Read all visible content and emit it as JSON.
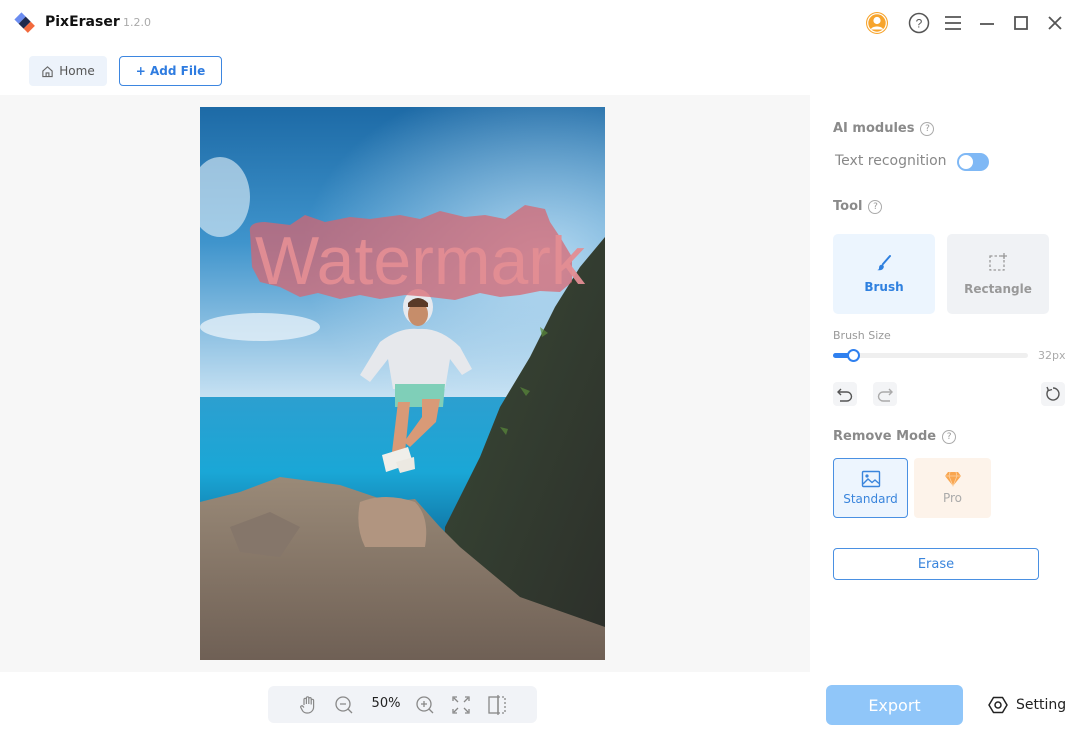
{
  "app": {
    "name": "PixEraser",
    "version": "1.2.0"
  },
  "window_controls": [
    {
      "name": "account-icon",
      "label": "Account"
    },
    {
      "name": "help-icon",
      "label": "Help"
    },
    {
      "name": "menu-icon",
      "label": "Menu"
    },
    {
      "name": "minimize-icon",
      "label": "Minimize"
    },
    {
      "name": "maximize-icon",
      "label": "Maximize"
    },
    {
      "name": "close-icon",
      "label": "Close"
    }
  ],
  "nav": {
    "home_label": "Home",
    "add_file_label": "+ Add File"
  },
  "canvas": {
    "watermark_text": "Watermark",
    "zoom_level": "50%",
    "mask_color": "#d9646e"
  },
  "panel": {
    "ai_modules_title": "AI modules",
    "text_recognition_label": "Text recognition",
    "text_recognition_enabled": false,
    "tool_title": "Tool",
    "tools": [
      {
        "label": "Brush",
        "selected": true
      },
      {
        "label": "Rectangle",
        "selected": false
      }
    ],
    "brush_size_label": "Brush Size",
    "brush_size_value": "32px",
    "brush_size_fraction": 0.1,
    "remove_mode_title": "Remove Mode",
    "modes": [
      {
        "label": "Standard",
        "selected": true
      },
      {
        "label": "Pro",
        "selected": false
      }
    ],
    "erase_label": "Erase"
  },
  "footer": {
    "export_label": "Export",
    "setting_label": "Setting"
  },
  "colors": {
    "accent": "#2f80df",
    "export_bg": "#90c6f9",
    "account_orange": "#f7a42c"
  }
}
